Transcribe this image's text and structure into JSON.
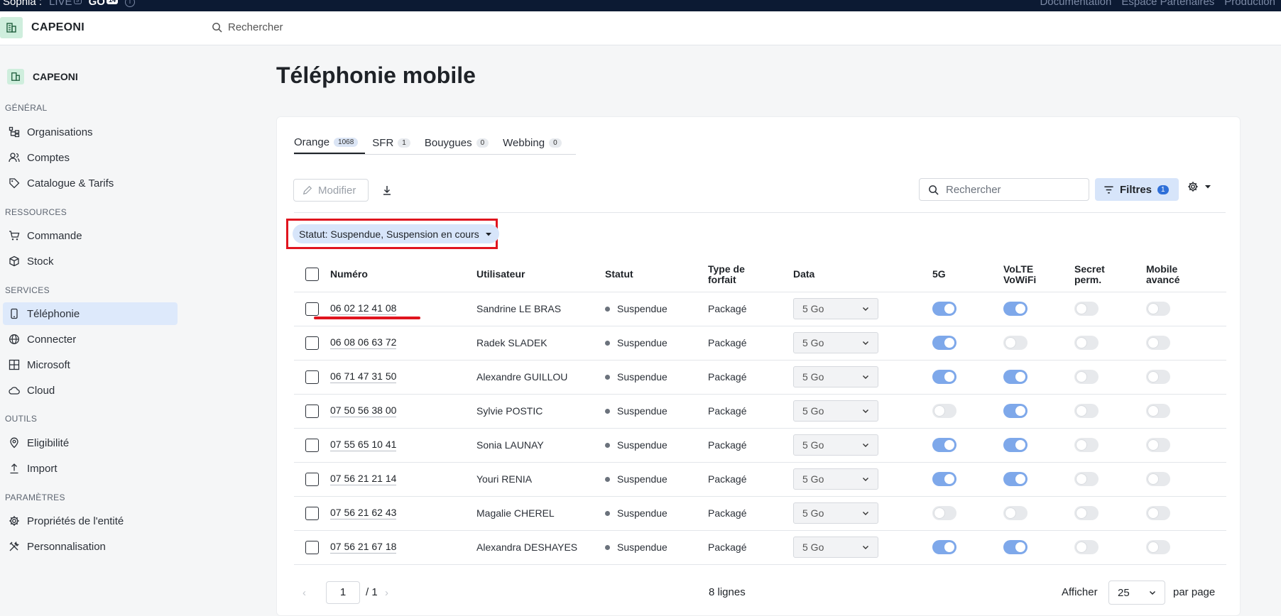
{
  "topbar": {
    "user": "Sophia :",
    "env_live": "LIVE",
    "env_live_badge": "9",
    "env_go": "GO",
    "env_go_badge": "14",
    "links": [
      "Documentation",
      "Espace Partenaires",
      "Production"
    ]
  },
  "header": {
    "brand": "CAPEONI",
    "search_placeholder": "Rechercher"
  },
  "sidebar": {
    "org_name": "CAPEONI",
    "sections": [
      {
        "title": "GÉNÉRAL",
        "items": [
          {
            "label": "Organisations",
            "icon": "org-tree-icon"
          },
          {
            "label": "Comptes",
            "icon": "users-icon"
          },
          {
            "label": "Catalogue & Tarifs",
            "icon": "tag-icon"
          }
        ]
      },
      {
        "title": "RESSOURCES",
        "items": [
          {
            "label": "Commande",
            "icon": "cart-icon"
          },
          {
            "label": "Stock",
            "icon": "box-icon"
          }
        ]
      },
      {
        "title": "SERVICES",
        "items": [
          {
            "label": "Téléphonie",
            "icon": "phone-icon",
            "active": true
          },
          {
            "label": "Connecter",
            "icon": "globe-icon"
          },
          {
            "label": "Microsoft",
            "icon": "grid-icon"
          },
          {
            "label": "Cloud",
            "icon": "cloud-icon"
          }
        ]
      },
      {
        "title": "OUTILS",
        "items": [
          {
            "label": "Eligibilité",
            "icon": "map-pin-icon"
          },
          {
            "label": "Import",
            "icon": "upload-icon"
          }
        ]
      },
      {
        "title": "PARAMÈTRES",
        "items": [
          {
            "label": "Propriétés de l'entité",
            "icon": "gear-icon"
          },
          {
            "label": "Personnalisation",
            "icon": "tools-icon"
          }
        ]
      }
    ]
  },
  "main": {
    "title": "Téléphonie mobile",
    "tabs": [
      {
        "label": "Orange",
        "count": "1068",
        "active": true
      },
      {
        "label": "SFR",
        "count": "1"
      },
      {
        "label": "Bouygues",
        "count": "0"
      },
      {
        "label": "Webbing",
        "count": "0"
      }
    ],
    "toolbar": {
      "modify_label": "Modifier",
      "search_placeholder": "Rechercher",
      "filters_label": "Filtres",
      "filters_count": "1"
    },
    "filter_chip": "Statut: Suspendue, Suspension en cours",
    "columns": {
      "numero": "Numéro",
      "utilisateur": "Utilisateur",
      "statut": "Statut",
      "type_forfait": "Type de forfait",
      "data": "Data",
      "fiveg": "5G",
      "volte": "VoLTE VoWiFi",
      "secret": "Secret perm.",
      "mobile_avance": "Mobile avancé"
    },
    "rows": [
      {
        "numero": "06 02 12 41 08",
        "utilisateur": "Sandrine LE BRAS",
        "statut": "Suspendue",
        "forfait": "Packagé",
        "data": "5 Go",
        "fiveg": true,
        "volte": true,
        "secret": false,
        "mobile": false
      },
      {
        "numero": "06 08 06 63 72",
        "utilisateur": "Radek SLADEK",
        "statut": "Suspendue",
        "forfait": "Packagé",
        "data": "5 Go",
        "fiveg": true,
        "volte": false,
        "secret": false,
        "mobile": false
      },
      {
        "numero": "06 71 47 31 50",
        "utilisateur": "Alexandre GUILLOU",
        "statut": "Suspendue",
        "forfait": "Packagé",
        "data": "5 Go",
        "fiveg": true,
        "volte": true,
        "secret": false,
        "mobile": false
      },
      {
        "numero": "07 50 56 38 00",
        "utilisateur": "Sylvie POSTIC",
        "statut": "Suspendue",
        "forfait": "Packagé",
        "data": "5 Go",
        "fiveg": false,
        "volte": true,
        "secret": false,
        "mobile": false
      },
      {
        "numero": "07 55 65 10 41",
        "utilisateur": "Sonia LAUNAY",
        "statut": "Suspendue",
        "forfait": "Packagé",
        "data": "5 Go",
        "fiveg": true,
        "volte": true,
        "secret": false,
        "mobile": false
      },
      {
        "numero": "07 56 21 21 14",
        "utilisateur": "Youri RENIA",
        "statut": "Suspendue",
        "forfait": "Packagé",
        "data": "5 Go",
        "fiveg": true,
        "volte": true,
        "secret": false,
        "mobile": false
      },
      {
        "numero": "07 56 21 62 43",
        "utilisateur": "Magalie CHEREL",
        "statut": "Suspendue",
        "forfait": "Packagé",
        "data": "5 Go",
        "fiveg": false,
        "volte": false,
        "secret": false,
        "mobile": false
      },
      {
        "numero": "07 56 21 67 18",
        "utilisateur": "Alexandra DESHAYES",
        "statut": "Suspendue",
        "forfait": "Packagé",
        "data": "5 Go",
        "fiveg": true,
        "volte": true,
        "secret": false,
        "mobile": false
      }
    ],
    "pagination": {
      "prev": "‹",
      "page": "1",
      "total": "/ 1",
      "next": "›",
      "row_count": "8 lignes",
      "show_label": "Afficher",
      "per_page": "25",
      "per_page_suffix": "par page"
    }
  },
  "colors": {
    "accent": "#2e6fd8",
    "toggle_on": "#7ea8ea",
    "highlight": "#e0141e"
  }
}
